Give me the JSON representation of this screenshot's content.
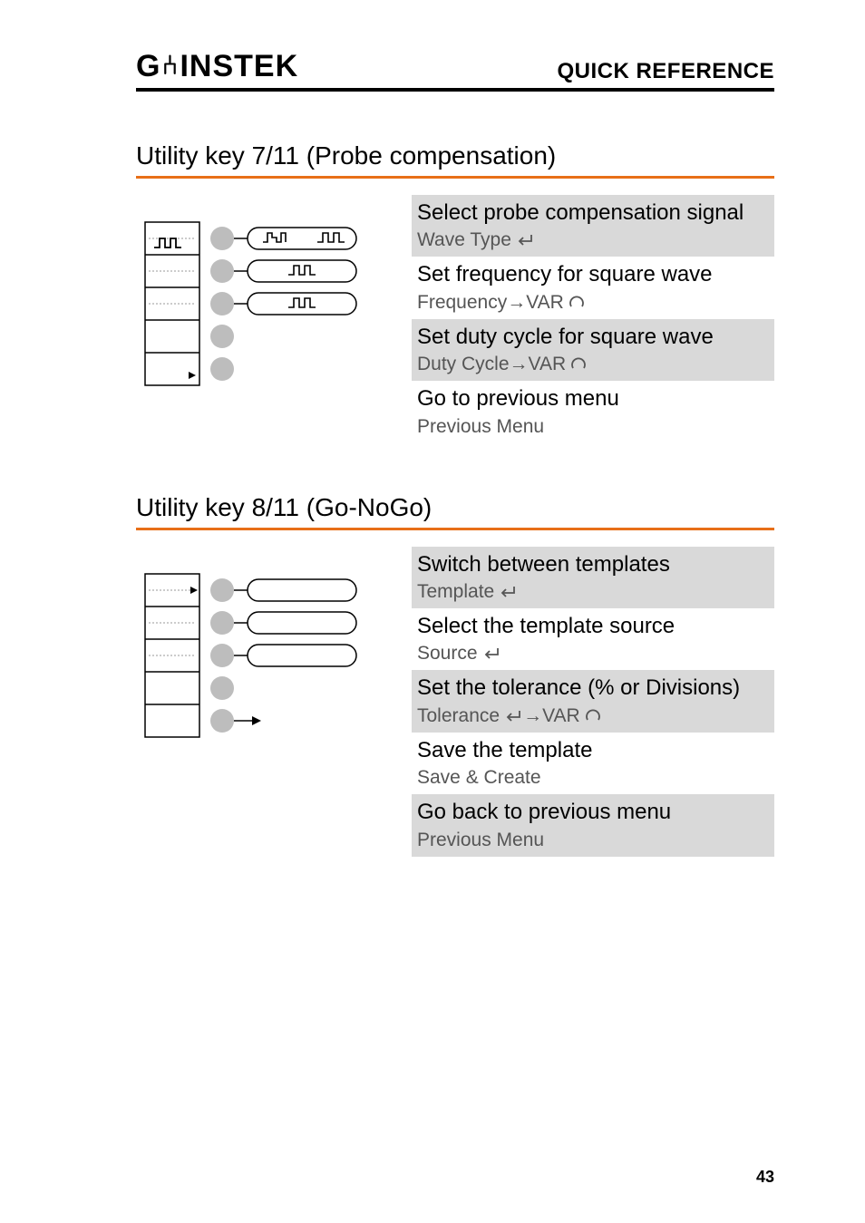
{
  "header": {
    "brand_g": "G",
    "brand_sep": "⑃",
    "brand_rest": "INSTEK",
    "section": "QUICK REFERENCE"
  },
  "utility711": {
    "heading": "Utility key 7/11 (Probe compensation)",
    "rows": [
      {
        "title": "Select probe compensation signal",
        "action": "Wave Type",
        "action_icon": "enter"
      },
      {
        "title": "Set frequency for square wave",
        "action": "Frequency→VAR",
        "action_icon": "knob"
      },
      {
        "title": "Set duty cycle for square wave",
        "action": "Duty Cycle→VAR",
        "action_icon": "knob"
      },
      {
        "title": "Go to previous menu",
        "action": "Previous Menu",
        "action_icon": ""
      }
    ]
  },
  "utility811": {
    "heading": "Utility key 8/11 (Go-NoGo)",
    "rows": [
      {
        "title": "Switch between templates",
        "action": "Template",
        "action_icon": "enter"
      },
      {
        "title": "Select the template source",
        "action": "Source",
        "action_icon": "enter"
      },
      {
        "title": "Set the tolerance (% or Divisions)",
        "action": "Tolerance",
        "action_mid_icon": "enter",
        "action_suffix": "→VAR",
        "action_icon": "knob"
      },
      {
        "title": "Save the template",
        "action": "Save & Create",
        "action_icon": ""
      },
      {
        "title": "Go back to previous menu",
        "action": "Previous Menu",
        "action_icon": ""
      }
    ]
  },
  "page_number": "43"
}
